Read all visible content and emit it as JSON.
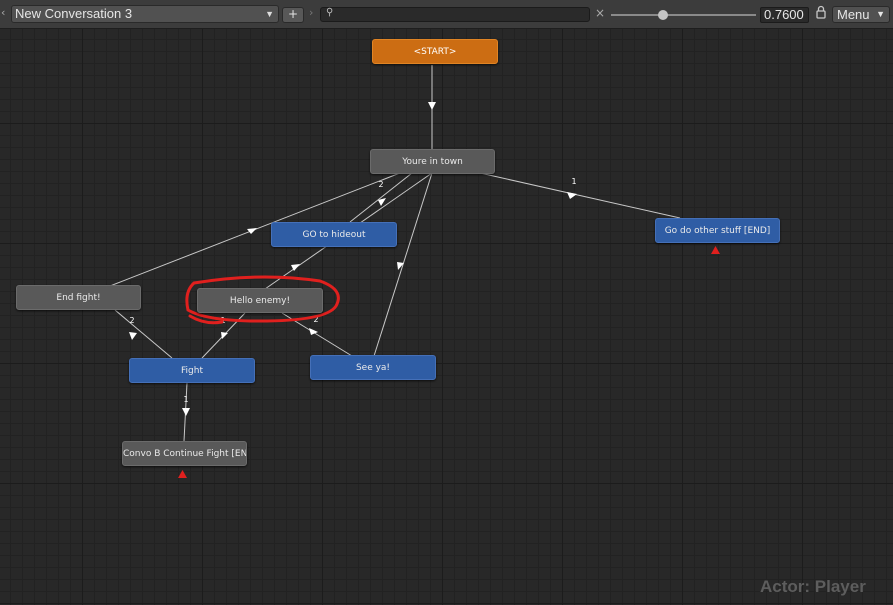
{
  "toolbar": {
    "conversation_name": "New Conversation 3",
    "add_label": "+",
    "search_placeholder": "",
    "zoom_value": "0.7600",
    "menu_label": "Menu"
  },
  "nodes": {
    "start": "<START>",
    "youre_in_town": "Youre in town",
    "go_to_hideout": "GO to hideout",
    "go_do_other_stuff": "Go do other stuff [END]",
    "end_fight": "End fight!",
    "hello_enemy": "Hello enemy!",
    "fight": "Fight",
    "see_ya": "See ya!",
    "convo_b": "Convo B Continue Fight [EN"
  },
  "link_labels": {
    "town_to_end_fight": "2",
    "town_to_other_stuff": "1",
    "end_fight_to_fight": "2",
    "hello_to_see_ya": "2",
    "fight_to_hello": "1",
    "fight_to_convo_b": "1"
  },
  "actor_label": "Actor: Player",
  "colors": {
    "start_node": "#cc6d13",
    "npc_node": "#595959",
    "player_node": "#2f5da5",
    "annotation": "#e0201e",
    "end_marker": "#e0201e"
  }
}
